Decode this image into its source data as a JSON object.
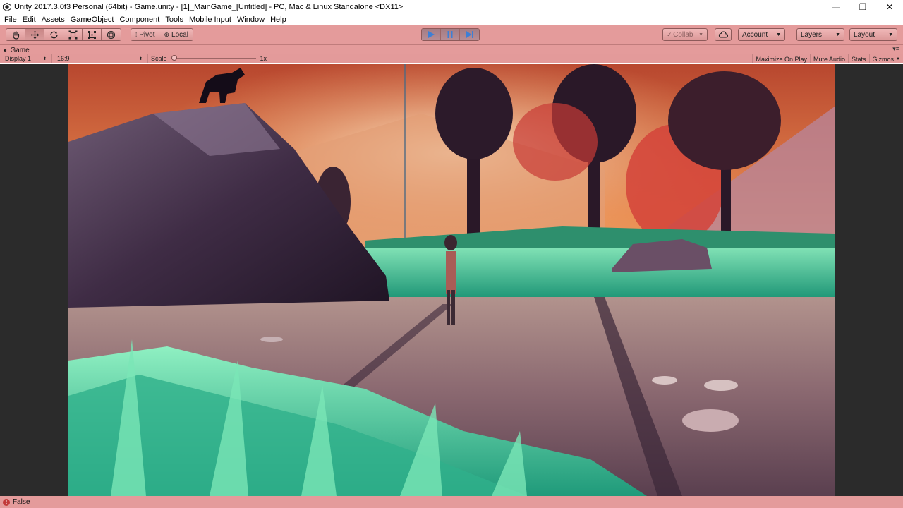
{
  "window": {
    "title": "Unity 2017.3.0f3 Personal (64bit) - Game.unity - [1]_MainGame_[Untitled] - PC, Mac & Linux Standalone <DX11>",
    "minimize": "—",
    "maximize": "❐",
    "close": "✕"
  },
  "menu": {
    "items": [
      "File",
      "Edit",
      "Assets",
      "GameObject",
      "Component",
      "Tools",
      "Mobile Input",
      "Window",
      "Help"
    ]
  },
  "toolbar": {
    "pivot": "Pivot",
    "local": "Local",
    "collab": "Collab",
    "account": "Account",
    "layers": "Layers",
    "layout": "Layout"
  },
  "game_panel": {
    "tab_label": "Game",
    "display": "Display 1",
    "aspect": "16:9",
    "scale_label": "Scale",
    "scale_value": "1x",
    "scale_fraction": 0.0,
    "maximize_on_play": "Maximize On Play",
    "mute_audio": "Mute Audio",
    "stats": "Stats",
    "gizmos": "Gizmos"
  },
  "status": {
    "message": "False"
  },
  "colors": {
    "play_mode_tint": "#e49b9b",
    "viewport_bg": "#2b2b2b",
    "play_button_active": "#3d7fd6"
  }
}
